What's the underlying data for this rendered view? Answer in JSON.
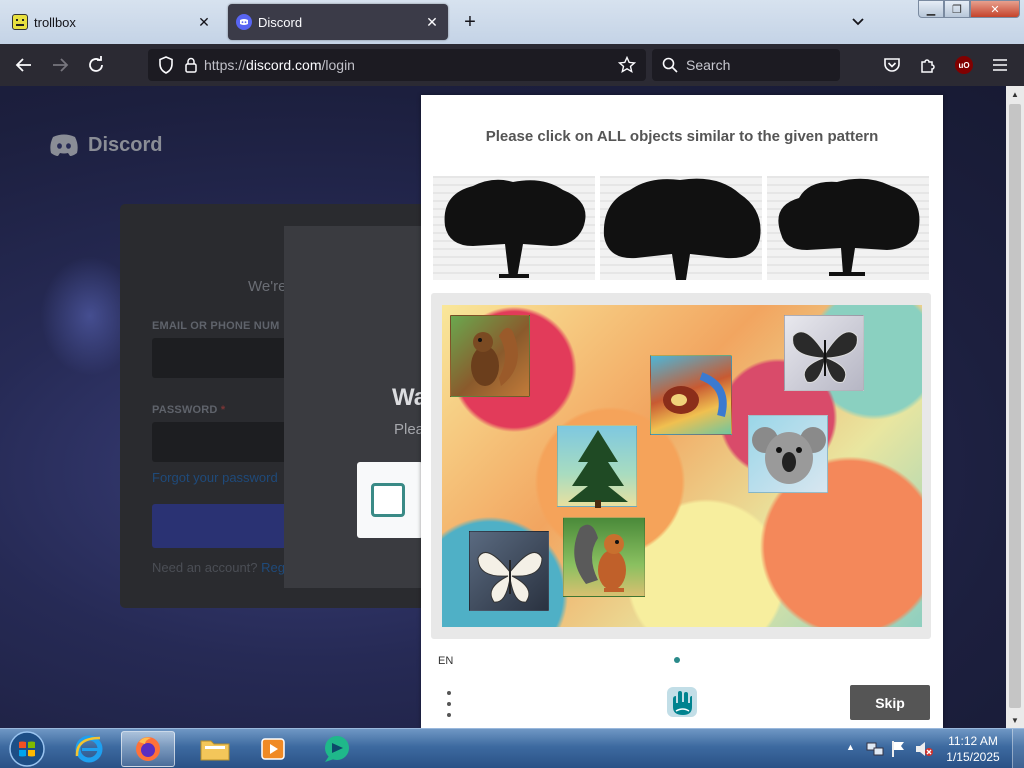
{
  "tabs": [
    {
      "title": "trollbox",
      "icon": "trollbox-favicon",
      "active": false
    },
    {
      "title": "Discord",
      "icon": "discord-favicon",
      "active": true
    }
  ],
  "url": {
    "scheme": "https://",
    "domain": "discord.com",
    "path": "/login"
  },
  "search": {
    "placeholder": "Search"
  },
  "discord": {
    "brand": "Discord",
    "welcome": "We're",
    "email_label": "EMAIL OR PHONE NUM",
    "password_label": "PASSWORD",
    "password_required": "*",
    "forgot": "Forgot your password",
    "need_account": "Need an account?",
    "register": "Reg",
    "heading": "Wa",
    "subtext": "Plea"
  },
  "captcha": {
    "prompt": "Please click on ALL objects similar to the given pattern",
    "language": "EN",
    "skip_label": "Skip",
    "examples": [
      "tree",
      "tree",
      "tree"
    ],
    "tiles": [
      "squirrel",
      "butterfly",
      "abstract-swirl",
      "pine-tree",
      "koala",
      "butterfly",
      "squirrel"
    ]
  },
  "taskbar": {
    "pinned": [
      "internet-explorer",
      "firefox",
      "file-explorer",
      "media-player",
      "app-bubble"
    ],
    "time": "11:12 AM",
    "date": "1/15/2025"
  },
  "colors": {
    "accent": "#2a8a8a",
    "discord_blurple": "#5865f2",
    "firefox_dark": "#2b2a33"
  }
}
